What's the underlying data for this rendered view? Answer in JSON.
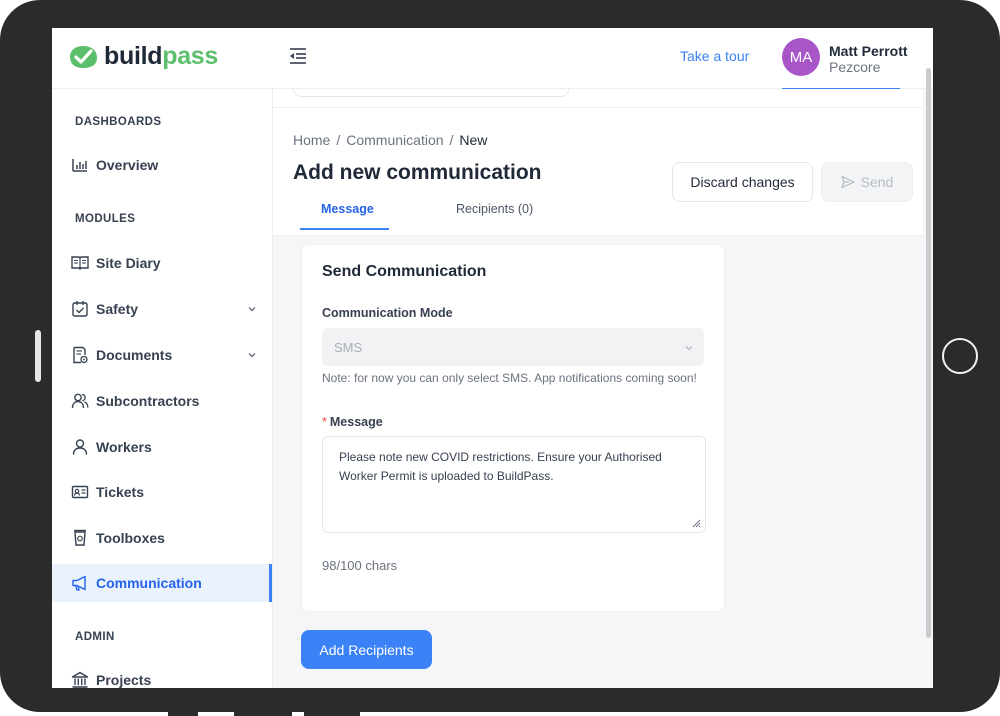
{
  "app": {
    "logo_build": "build",
    "logo_pass": "pass",
    "brand_color": "#5cbf6b",
    "accent_color": "#3b82f6"
  },
  "header": {
    "take_tour": "Take a tour",
    "user": {
      "initials": "MA",
      "name": "Matt Perrott",
      "org": "Pezcore",
      "avatar_color": "#a855c8"
    }
  },
  "sidebar": {
    "section_dashboards": "DASHBOARDS",
    "section_modules": "MODULES",
    "section_admin": "ADMIN",
    "items": [
      {
        "label": "Overview",
        "icon": "bar-chart-icon"
      },
      {
        "label": "Site Diary",
        "icon": "book-open-icon"
      },
      {
        "label": "Safety",
        "icon": "calendar-check-icon",
        "expandable": true
      },
      {
        "label": "Documents",
        "icon": "document-settings-icon",
        "expandable": true
      },
      {
        "label": "Subcontractors",
        "icon": "users-icon"
      },
      {
        "label": "Workers",
        "icon": "user-icon"
      },
      {
        "label": "Tickets",
        "icon": "id-card-icon"
      },
      {
        "label": "Toolboxes",
        "icon": "cup-icon"
      },
      {
        "label": "Communication",
        "icon": "megaphone-icon",
        "active": true
      },
      {
        "label": "Projects",
        "icon": "bank-icon"
      }
    ]
  },
  "breadcrumb": {
    "home": "Home",
    "section": "Communication",
    "current": "New",
    "separator": "/"
  },
  "page": {
    "title": "Add new communication",
    "discard_label": "Discard changes",
    "send_label": "Send",
    "tabs": [
      {
        "label": "Message",
        "active": true
      },
      {
        "label": "Recipients (0)",
        "active": false
      }
    ]
  },
  "form": {
    "card_title": "Send Communication",
    "mode_label": "Communication Mode",
    "mode_value": "SMS",
    "mode_note": "Note: for now you can only select SMS. App notifications coming soon!",
    "message_required_mark": "*",
    "message_label": "Message",
    "message_value": "Please note new COVID restrictions. Ensure your Authorised Worker Permit is uploaded to BuildPass.",
    "char_count": "98/100 chars",
    "add_recipients_label": "Add Recipients"
  }
}
